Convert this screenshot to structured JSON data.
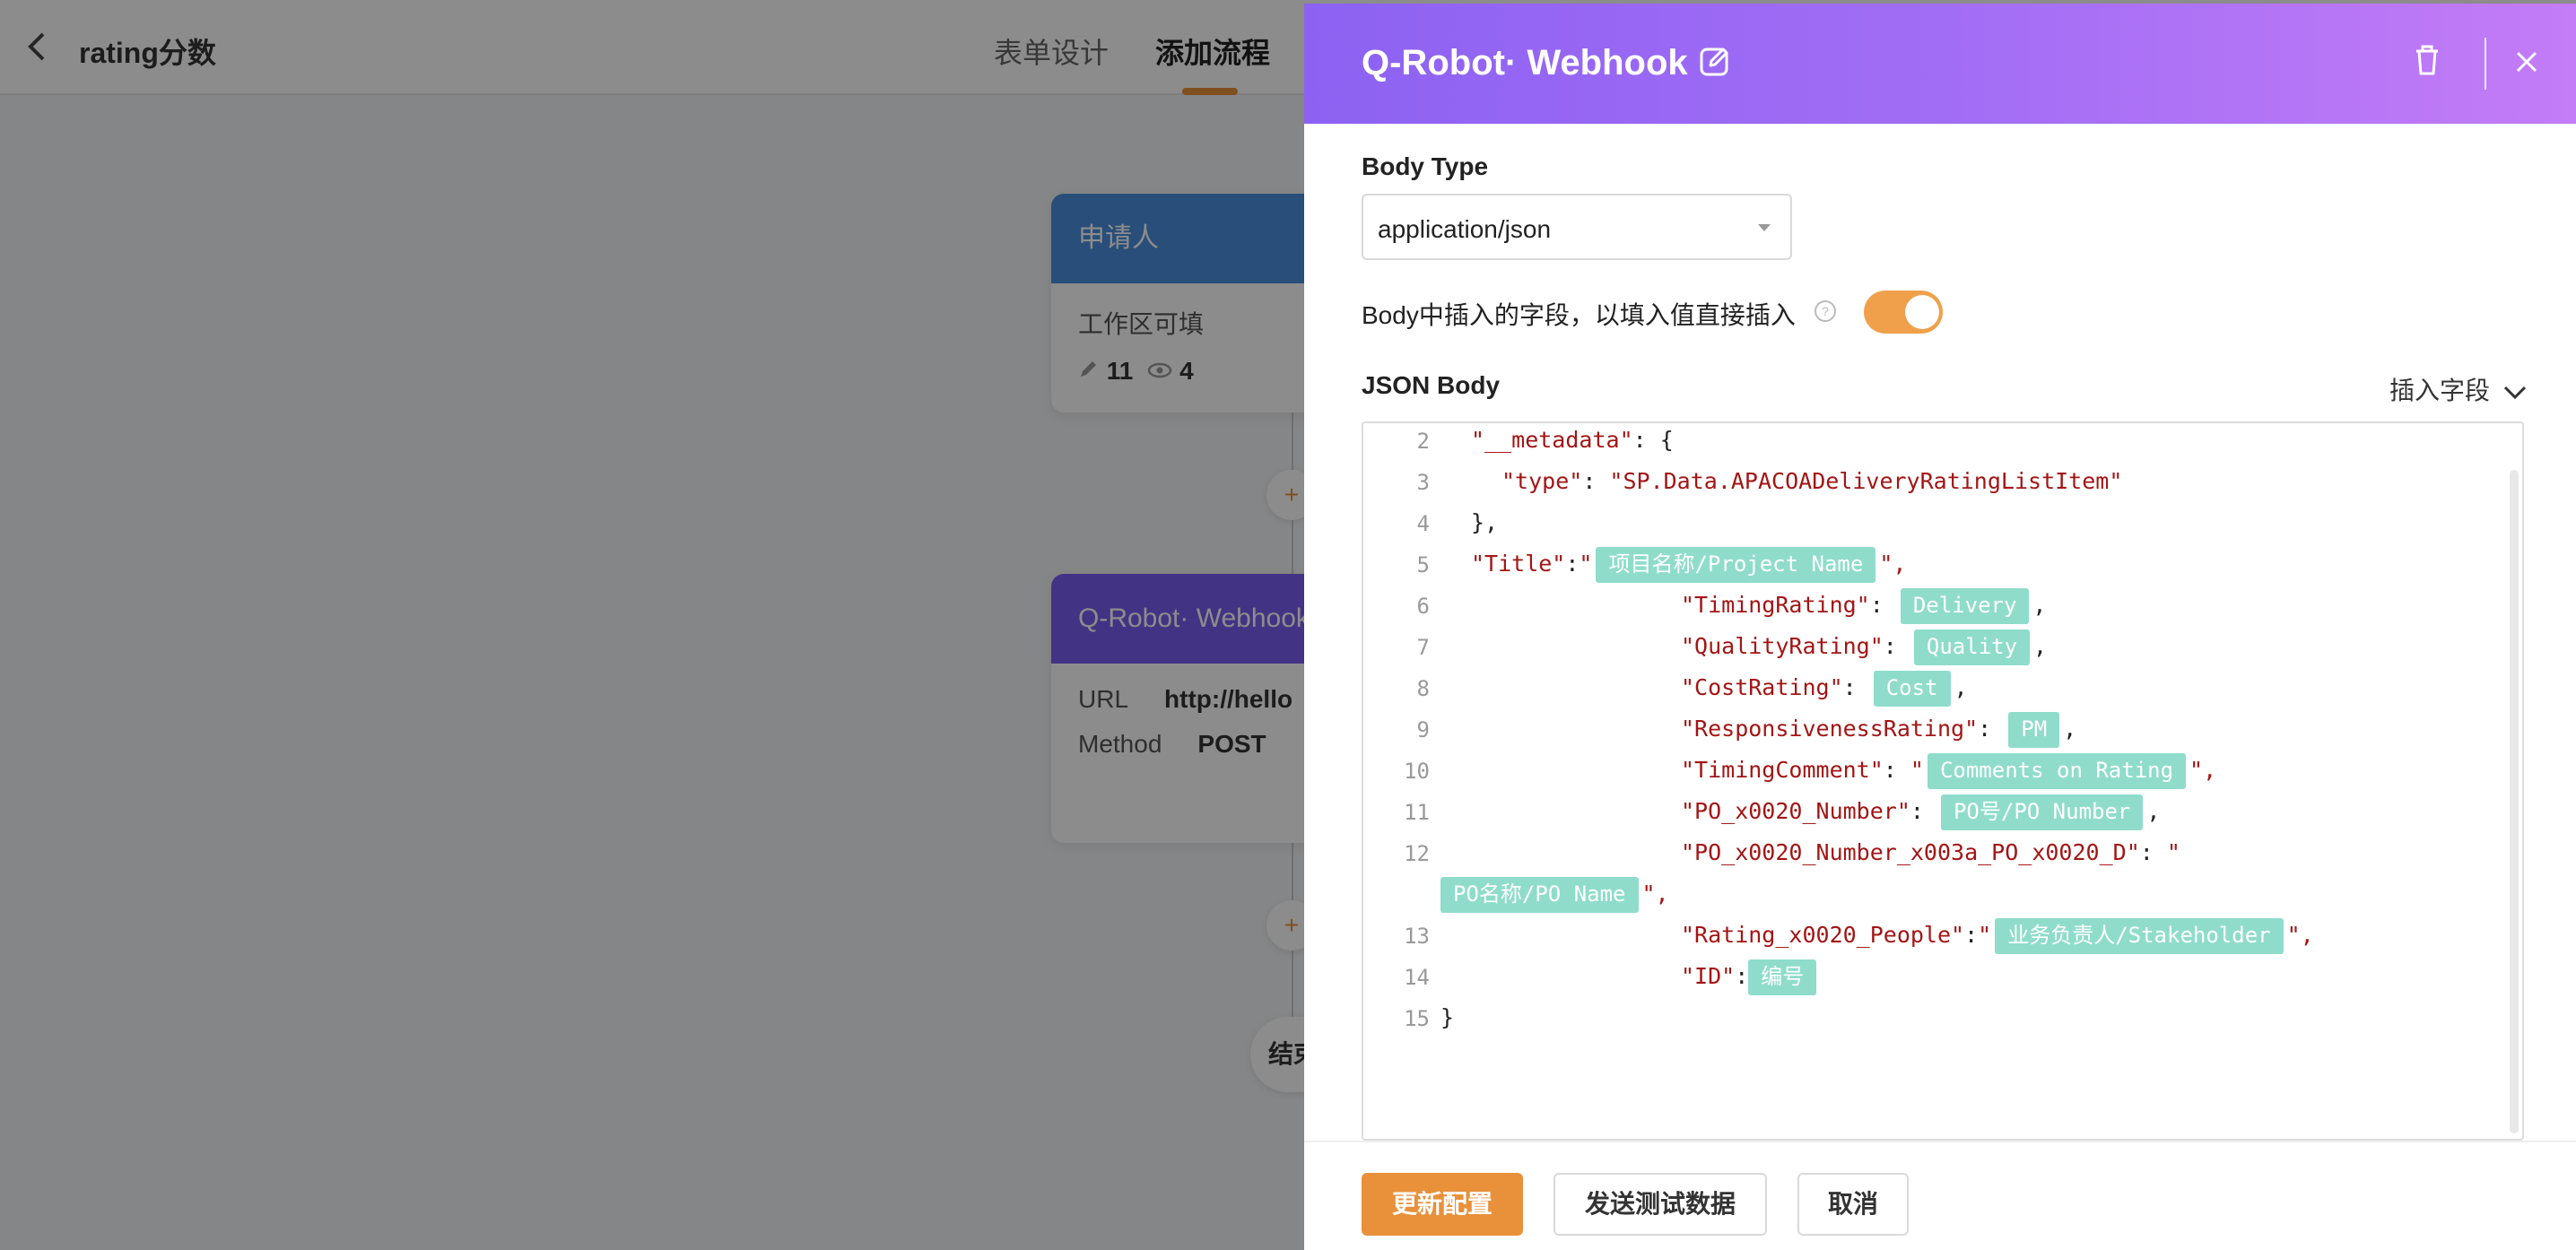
{
  "app": {
    "back_icon": "chevron-left-icon",
    "title": "rating分数",
    "tabs": [
      {
        "label": "表单设计"
      },
      {
        "label": "添加流程"
      }
    ]
  },
  "flow": {
    "node1": {
      "title": "申请人",
      "field_note": "工作区可填",
      "edit_count": "11",
      "view_count": "4"
    },
    "node2": {
      "title": "Q-Robot· Webhook",
      "url_label": "URL",
      "url_value": "http://hello",
      "method_label": "Method",
      "method_value": "POST"
    },
    "end_label": "结束",
    "plus_symbol": "+"
  },
  "drawer": {
    "title": "Q-Robot· Webhook",
    "body_type_label": "Body Type",
    "body_type_value": "application/json",
    "toggle_label": "Body中插入的字段，以填入值直接插入",
    "toggle_on": true,
    "json_body_label": "JSON Body",
    "insert_field_label": "插入字段",
    "buttons": {
      "update": "更新配置",
      "send_test": "发送测试数据",
      "cancel": "取消"
    },
    "colors": {
      "accent": "#e8913a",
      "header_start": "#8d62f2",
      "header_end": "#c47cf7",
      "tag": "#8fdccb"
    }
  },
  "code": {
    "line_numbers": [
      "2",
      "3",
      "4",
      "5",
      "6",
      "7",
      "8",
      "9",
      "10",
      "11",
      "12",
      "",
      "13",
      "14",
      "15"
    ],
    "l2_key": "\"__metadata\"",
    "l2_rest": ": {",
    "l3_key": "\"type\"",
    "l3_sep": ": ",
    "l3_val": "\"SP.Data.APACOADeliveryRatingListItem\"",
    "l4": "},",
    "l5_key": "\"Title\"",
    "l5_sep": ":",
    "l5_q": "\"",
    "l5_tag": "项目名称/Project Name",
    "l5_end": "\",",
    "l6_key": "\"TimingRating\"",
    "l6_sep": ": ",
    "l6_tag": "Delivery",
    "l6_end": ",",
    "l7_key": "\"QualityRating\"",
    "l7_sep": ": ",
    "l7_tag": "Quality",
    "l7_end": ",",
    "l8_key": "\"CostRating\"",
    "l8_sep": ": ",
    "l8_tag": "Cost",
    "l8_end": ",",
    "l9_key": "\"ResponsivenessRating\"",
    "l9_sep": ": ",
    "l9_tag": "PM",
    "l9_end": ",",
    "l10_key": "\"TimingComment\"",
    "l10_sep": ": ",
    "l10_q": "\"",
    "l10_tag": "Comments on Rating",
    "l10_end": "\",",
    "l11_key": "\"PO_x0020_Number\"",
    "l11_sep": ": ",
    "l11_tag": "PO号/PO Number",
    "l11_end": ",",
    "l12_key": "\"PO_x0020_Number_x003a_PO_x0020_D\"",
    "l12_sep": ": ",
    "l12_q": "\"",
    "l12b_tag": "PO名称/PO Name",
    "l12b_end": "\",",
    "l13_key": "\"Rating_x0020_People\"",
    "l13_sep": ":",
    "l13_q": "\"",
    "l13_tag": "业务负责人/Stakeholder",
    "l13_end": "\",",
    "l14_key": "\"ID\"",
    "l14_sep": ":",
    "l14_tag": "编号",
    "l15": "}"
  }
}
